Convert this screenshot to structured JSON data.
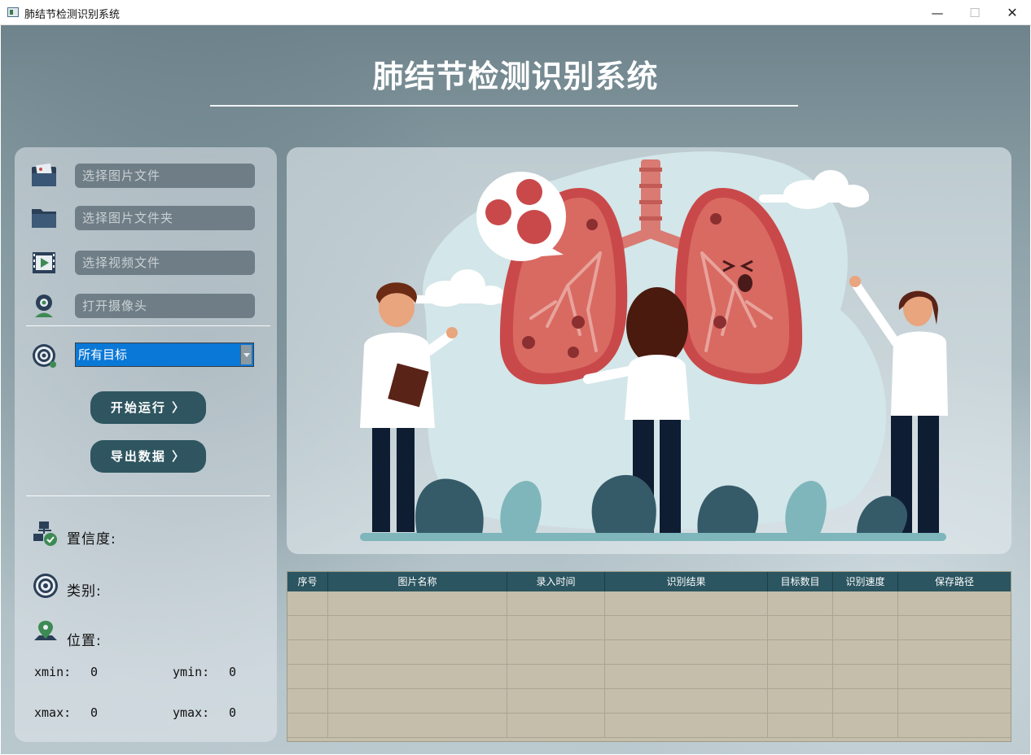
{
  "window": {
    "title": "肺结节检测识别系统",
    "min_glyph": "—",
    "max_glyph": "☐",
    "close_glyph": "✕"
  },
  "header": {
    "title": "肺结节检测识别系统"
  },
  "inputs": [
    {
      "id": "image",
      "icon": "image-folder-icon",
      "placeholder": "选择图片文件"
    },
    {
      "id": "folder",
      "icon": "folder-icon",
      "placeholder": "选择图片文件夹"
    },
    {
      "id": "video",
      "icon": "video-file-icon",
      "placeholder": "选择视频文件"
    },
    {
      "id": "camera",
      "icon": "webcam-icon",
      "placeholder": "打开摄像头"
    }
  ],
  "target_select": {
    "icon": "target-icon",
    "value": "所有目标"
  },
  "buttons": {
    "run": "开始运行 〉",
    "export": "导出数据 〉"
  },
  "info": {
    "confidence_label": "置信度:",
    "class_label": "类别:",
    "position_label": "位置:",
    "xmin_label": "xmin:",
    "xmin_value": "0",
    "ymin_label": "ymin:",
    "ymin_value": "0",
    "xmax_label": "xmax:",
    "xmax_value": "0",
    "ymax_label": "ymax:",
    "ymax_value": "0"
  },
  "table": {
    "columns": [
      "序号",
      "图片名称",
      "录入时间",
      "识别结果",
      "目标数目",
      "识别速度",
      "保存路径"
    ],
    "row_count": 6
  },
  "colors": {
    "accent_button": "#2f5660",
    "select_highlight": "#0a78d7",
    "table_header": "#2b5560",
    "table_body": "#c4beaa"
  }
}
